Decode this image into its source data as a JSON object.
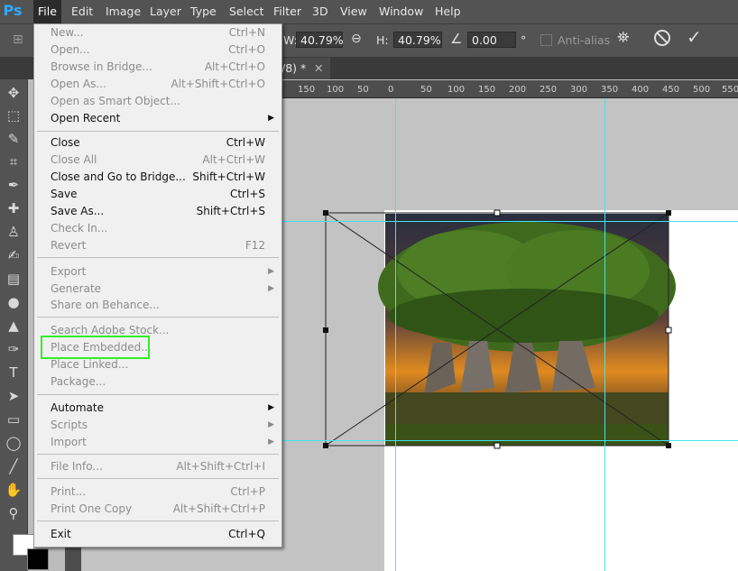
{
  "menubar": {
    "logo": "Ps",
    "items": [
      {
        "label": "File"
      },
      {
        "label": "Edit"
      },
      {
        "label": "Image"
      },
      {
        "label": "Layer"
      },
      {
        "label": "Type"
      },
      {
        "label": "Select"
      },
      {
        "label": "Filter"
      },
      {
        "label": "3D"
      },
      {
        "label": "View"
      },
      {
        "label": "Window"
      },
      {
        "label": "Help"
      }
    ]
  },
  "options": {
    "w_label": "W:",
    "w_value": "40.79%",
    "h_label": "H:",
    "h_value": "40.79%",
    "angle_value": "0.00",
    "angle_unit": "°",
    "antialias_label": "Anti-alias"
  },
  "document": {
    "tab_title": "/8) *"
  },
  "ruler": {
    "labels": [
      "150",
      "100",
      "50",
      "0",
      "50",
      "100",
      "150",
      "200",
      "250",
      "300",
      "350",
      "400",
      "450",
      "500",
      "550"
    ]
  },
  "file_menu": {
    "items": [
      {
        "label": "New...",
        "shortcut": "Ctrl+N",
        "disabled": true
      },
      {
        "label": "Open...",
        "shortcut": "Ctrl+O",
        "disabled": true
      },
      {
        "label": "Browse in Bridge...",
        "shortcut": "Alt+Ctrl+O",
        "disabled": true
      },
      {
        "label": "Open As...",
        "shortcut": "Alt+Shift+Ctrl+O",
        "disabled": true
      },
      {
        "label": "Open as Smart Object...",
        "shortcut": "",
        "disabled": true
      },
      {
        "label": "Open Recent",
        "shortcut": "",
        "disabled": false,
        "submenu": true
      },
      {
        "label": "Close",
        "shortcut": "Ctrl+W",
        "disabled": false
      },
      {
        "label": "Close All",
        "shortcut": "Alt+Ctrl+W",
        "disabled": true
      },
      {
        "label": "Close and Go to Bridge...",
        "shortcut": "Shift+Ctrl+W",
        "disabled": false
      },
      {
        "label": "Save",
        "shortcut": "Ctrl+S",
        "disabled": false
      },
      {
        "label": "Save As...",
        "shortcut": "Shift+Ctrl+S",
        "disabled": false
      },
      {
        "label": "Check In...",
        "shortcut": "",
        "disabled": true
      },
      {
        "label": "Revert",
        "shortcut": "F12",
        "disabled": true
      },
      {
        "label": "Export",
        "shortcut": "",
        "disabled": true,
        "submenu": true
      },
      {
        "label": "Generate",
        "shortcut": "",
        "disabled": true,
        "submenu": true
      },
      {
        "label": "Share on Behance...",
        "shortcut": "",
        "disabled": true
      },
      {
        "label": "Search Adobe Stock...",
        "shortcut": "",
        "disabled": true
      },
      {
        "label": "Place Embedded...",
        "shortcut": "",
        "disabled": true
      },
      {
        "label": "Place Linked...",
        "shortcut": "",
        "disabled": true
      },
      {
        "label": "Package...",
        "shortcut": "",
        "disabled": true
      },
      {
        "label": "Automate",
        "shortcut": "",
        "disabled": false,
        "submenu": true
      },
      {
        "label": "Scripts",
        "shortcut": "",
        "disabled": true,
        "submenu": true
      },
      {
        "label": "Import",
        "shortcut": "",
        "disabled": true,
        "submenu": true
      },
      {
        "label": "File Info...",
        "shortcut": "Alt+Shift+Ctrl+I",
        "disabled": true
      },
      {
        "label": "Print...",
        "shortcut": "Ctrl+P",
        "disabled": true
      },
      {
        "label": "Print One Copy",
        "shortcut": "Alt+Shift+Ctrl+P",
        "disabled": true
      },
      {
        "label": "Exit",
        "shortcut": "Ctrl+Q",
        "disabled": false
      }
    ]
  },
  "colors": {
    "guide": "#3ee6ee",
    "highlight": "#33ee2a",
    "accent": "#31a8ff"
  }
}
